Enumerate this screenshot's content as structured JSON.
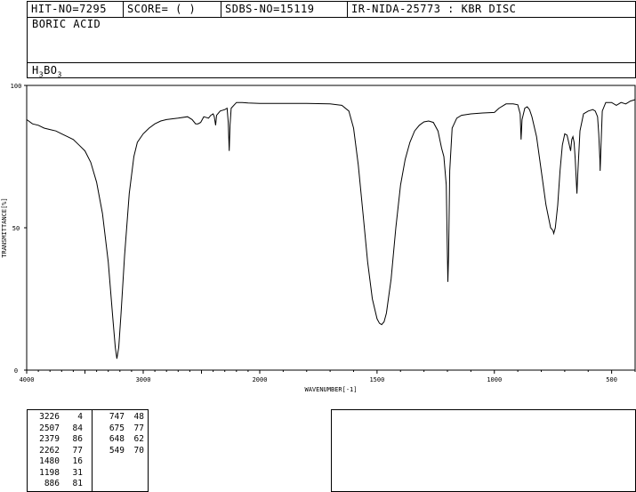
{
  "header": {
    "hit_no": "HIT-NO=7295",
    "score": "SCORE=  (   )",
    "sdbs_no": "SDBS-NO=15119",
    "ir_code": "IR-NIDA-25773 : KBR DISC",
    "compound_name": "BORIC ACID",
    "formula": {
      "prefix": "H",
      "sub1": "3",
      "mid": "BO",
      "sub2": "3"
    }
  },
  "chart_data": {
    "type": "line",
    "xlabel": "WAVENUMBER[-1]",
    "ylabel": "TRANSMITTANCE[%]",
    "xlim": [
      4000,
      400
    ],
    "ylim": [
      0,
      100
    ],
    "x_ticks": [
      "4000",
      "3000",
      "2000",
      "1500",
      "1000",
      "500"
    ],
    "y_ticks": [
      "0",
      "50",
      "100"
    ],
    "series": [
      {
        "color": "#000000",
        "points": [
          [
            4000,
            88
          ],
          [
            3950,
            86.5
          ],
          [
            3900,
            86
          ],
          [
            3850,
            85
          ],
          [
            3800,
            84.5
          ],
          [
            3750,
            84
          ],
          [
            3700,
            83
          ],
          [
            3650,
            82
          ],
          [
            3600,
            81
          ],
          [
            3550,
            79
          ],
          [
            3500,
            77
          ],
          [
            3450,
            73
          ],
          [
            3400,
            66
          ],
          [
            3350,
            55
          ],
          [
            3300,
            38
          ],
          [
            3260,
            18
          ],
          [
            3240,
            8
          ],
          [
            3226,
            4
          ],
          [
            3210,
            8
          ],
          [
            3190,
            20
          ],
          [
            3160,
            40
          ],
          [
            3120,
            62
          ],
          [
            3080,
            75
          ],
          [
            3050,
            80
          ],
          [
            3000,
            83
          ],
          [
            2950,
            85
          ],
          [
            2900,
            86.5
          ],
          [
            2850,
            87.5
          ],
          [
            2800,
            88
          ],
          [
            2700,
            88.5
          ],
          [
            2620,
            89
          ],
          [
            2580,
            88
          ],
          [
            2550,
            86.5
          ],
          [
            2530,
            86.5
          ],
          [
            2507,
            87
          ],
          [
            2480,
            89
          ],
          [
            2440,
            88.5
          ],
          [
            2420,
            89.5
          ],
          [
            2400,
            90
          ],
          [
            2390,
            89
          ],
          [
            2379,
            86
          ],
          [
            2370,
            89.5
          ],
          [
            2340,
            91
          ],
          [
            2300,
            91.5
          ],
          [
            2280,
            92
          ],
          [
            2270,
            87
          ],
          [
            2262,
            77
          ],
          [
            2255,
            86
          ],
          [
            2245,
            92
          ],
          [
            2200,
            94
          ],
          [
            2150,
            94
          ],
          [
            2100,
            93.8
          ],
          [
            2000,
            93.7
          ],
          [
            1900,
            93.7
          ],
          [
            1800,
            93.7
          ],
          [
            1700,
            93.5
          ],
          [
            1650,
            93
          ],
          [
            1620,
            91
          ],
          [
            1600,
            85
          ],
          [
            1580,
            72
          ],
          [
            1560,
            55
          ],
          [
            1540,
            38
          ],
          [
            1520,
            25
          ],
          [
            1500,
            18
          ],
          [
            1490,
            16.5
          ],
          [
            1480,
            16
          ],
          [
            1470,
            17
          ],
          [
            1460,
            20
          ],
          [
            1440,
            32
          ],
          [
            1420,
            50
          ],
          [
            1400,
            65
          ],
          [
            1380,
            74
          ],
          [
            1360,
            80
          ],
          [
            1340,
            84
          ],
          [
            1320,
            86
          ],
          [
            1300,
            87.2
          ],
          [
            1280,
            87.5
          ],
          [
            1260,
            87
          ],
          [
            1240,
            84
          ],
          [
            1225,
            78
          ],
          [
            1215,
            75
          ],
          [
            1205,
            65
          ],
          [
            1200,
            40
          ],
          [
            1198,
            31
          ],
          [
            1195,
            40
          ],
          [
            1190,
            70
          ],
          [
            1180,
            85
          ],
          [
            1160,
            88.5
          ],
          [
            1140,
            89.5
          ],
          [
            1100,
            90
          ],
          [
            1050,
            90.3
          ],
          [
            1000,
            90.5
          ],
          [
            980,
            92
          ],
          [
            950,
            93.5
          ],
          [
            920,
            93.5
          ],
          [
            900,
            93.2
          ],
          [
            890,
            90
          ],
          [
            886,
            81
          ],
          [
            882,
            88
          ],
          [
            870,
            92
          ],
          [
            860,
            92.5
          ],
          [
            850,
            91.5
          ],
          [
            840,
            89
          ],
          [
            820,
            82
          ],
          [
            800,
            70
          ],
          [
            780,
            58
          ],
          [
            760,
            50
          ],
          [
            750,
            49
          ],
          [
            747,
            48
          ],
          [
            740,
            50
          ],
          [
            730,
            58
          ],
          [
            720,
            70
          ],
          [
            710,
            79
          ],
          [
            700,
            83
          ],
          [
            690,
            82.5
          ],
          [
            680,
            79
          ],
          [
            675,
            77
          ],
          [
            670,
            81
          ],
          [
            665,
            82
          ],
          [
            660,
            80
          ],
          [
            655,
            74
          ],
          [
            650,
            65
          ],
          [
            648,
            62
          ],
          [
            645,
            68
          ],
          [
            635,
            84
          ],
          [
            620,
            90
          ],
          [
            600,
            91
          ],
          [
            580,
            91.5
          ],
          [
            570,
            91
          ],
          [
            560,
            89
          ],
          [
            555,
            83
          ],
          [
            550,
            74
          ],
          [
            549,
            70
          ],
          [
            545,
            80
          ],
          [
            540,
            91
          ],
          [
            525,
            94
          ],
          [
            500,
            94
          ],
          [
            480,
            93
          ],
          [
            460,
            94
          ],
          [
            440,
            93.5
          ],
          [
            420,
            94.5
          ],
          [
            400,
            95
          ]
        ]
      }
    ]
  },
  "peak_table": {
    "left": [
      [
        "3226",
        "4"
      ],
      [
        "2507",
        "84"
      ],
      [
        "2379",
        "86"
      ],
      [
        "2262",
        "77"
      ],
      [
        "1480",
        "16"
      ],
      [
        "1198",
        "31"
      ],
      [
        "886",
        "81"
      ]
    ],
    "right": [
      [
        "747",
        "48"
      ],
      [
        "675",
        "77"
      ],
      [
        "648",
        "62"
      ],
      [
        "549",
        "70"
      ]
    ]
  }
}
